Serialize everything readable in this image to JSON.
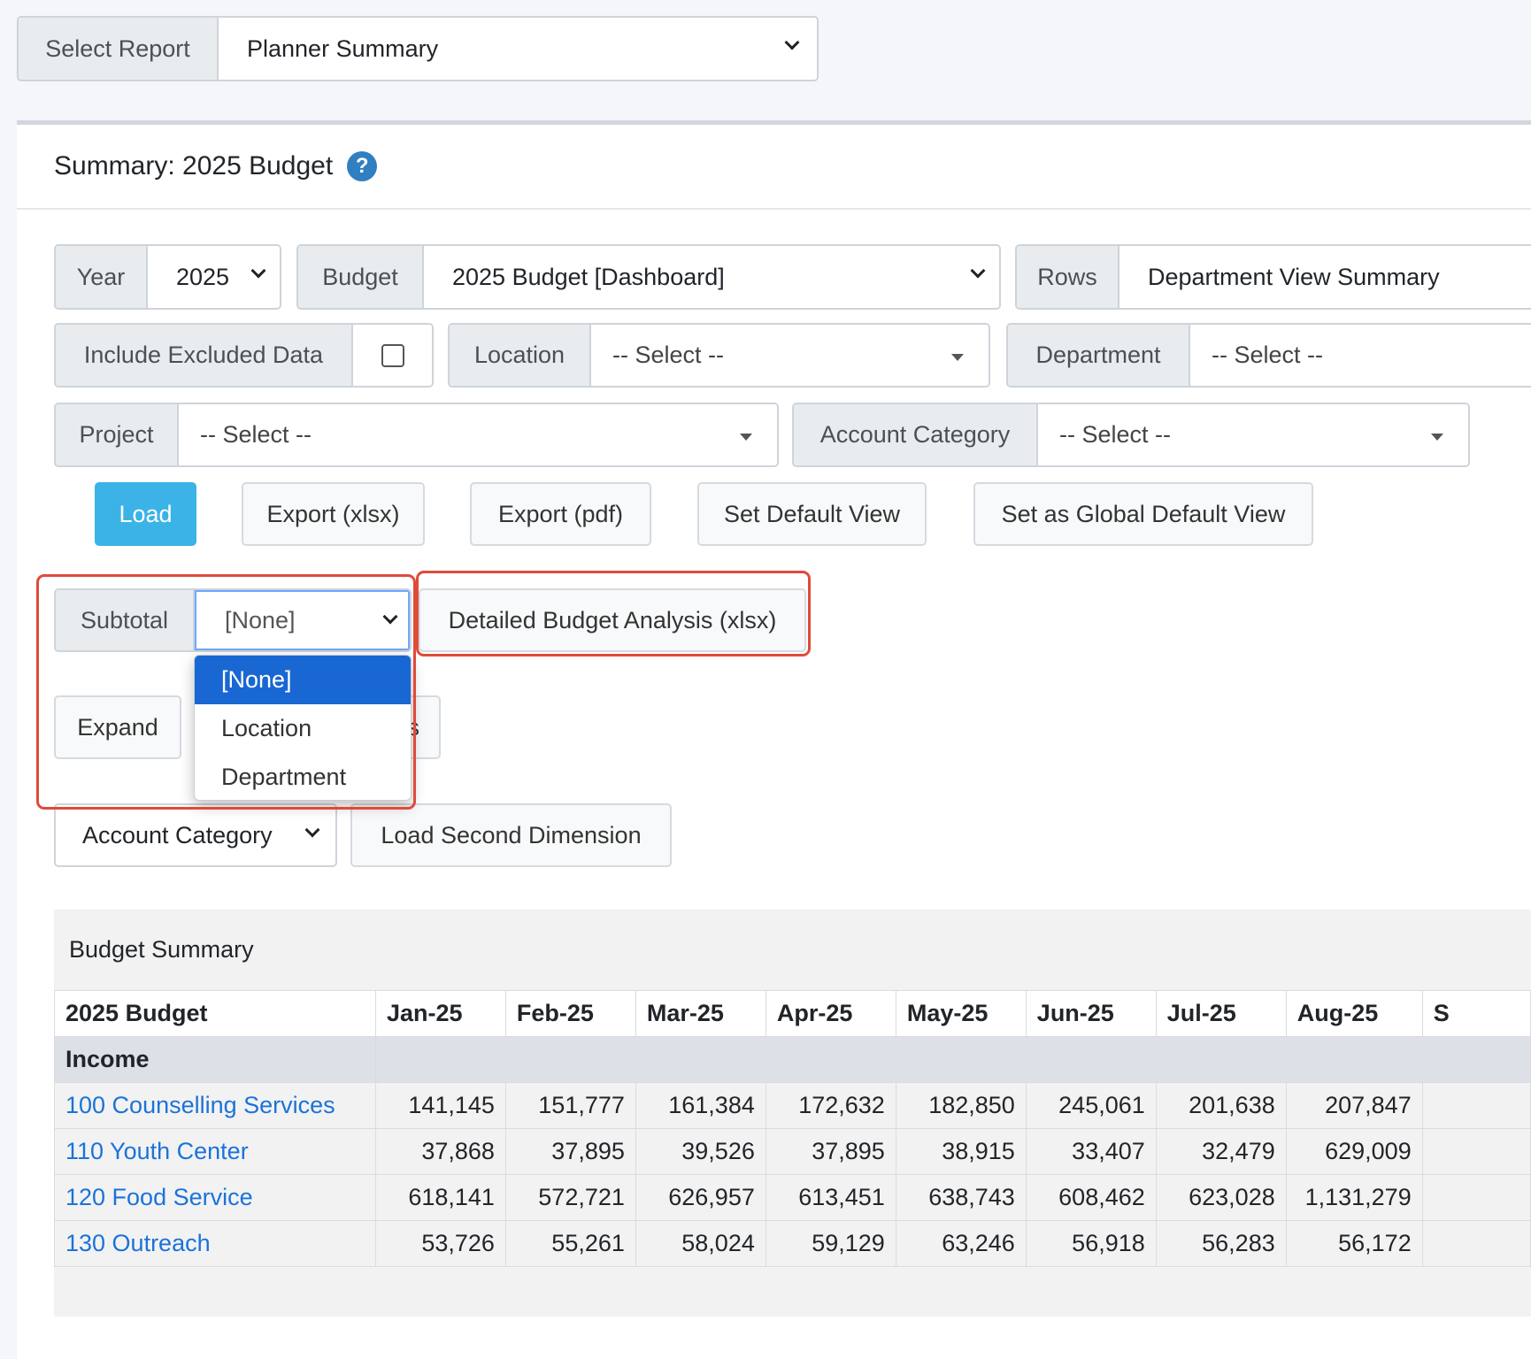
{
  "report_select": {
    "label": "Select Report",
    "value": "Planner Summary"
  },
  "panel": {
    "title": "Summary: 2025 Budget",
    "help_icon": "help-circle-icon"
  },
  "filters": {
    "year_label": "Year",
    "year_value": "2025",
    "budget_label": "Budget",
    "budget_value": "2025 Budget [Dashboard]",
    "rows_label": "Rows",
    "rows_value": "Department View Summary",
    "include_excluded_label": "Include Excluded Data",
    "include_excluded_checked": false,
    "location_label": "Location",
    "location_value": "-- Select --",
    "department_label": "Department",
    "department_value": "-- Select --",
    "project_label": "Project",
    "project_value": "-- Select --",
    "account_category_label": "Account Category",
    "account_category_value": "-- Select --"
  },
  "actions": {
    "load": "Load",
    "export_xlsx": "Export (xlsx)",
    "export_pdf": "Export (pdf)",
    "set_default": "Set Default View",
    "set_global_default": "Set as Global Default View"
  },
  "subtotal": {
    "label": "Subtotal",
    "value": "[None]",
    "options": [
      "[None]",
      "Location",
      "Department"
    ],
    "selected_index": 0
  },
  "detailed_analysis_button": "Detailed Budget Analysis (xlsx)",
  "expand_button": "Expand",
  "collapse_button_partial": "s",
  "second_dimension": {
    "select_value": "Account Category",
    "load_button": "Load Second Dimension"
  },
  "accent_colors": {
    "primary_button": "#3bb3e6",
    "link": "#1a73d9",
    "highlight": "#e04a3a",
    "selected_option": "#1967d2"
  },
  "table": {
    "section_title": "Budget Summary",
    "headers": [
      "2025 Budget",
      "Jan-25",
      "Feb-25",
      "Mar-25",
      "Apr-25",
      "May-25",
      "Jun-25",
      "Jul-25",
      "Aug-25",
      "S"
    ],
    "group": "Income",
    "rows": [
      {
        "name": "100 Counselling Services",
        "values": [
          "141,145",
          "151,777",
          "161,384",
          "172,632",
          "182,850",
          "245,061",
          "201,638",
          "207,847"
        ]
      },
      {
        "name": "110 Youth Center",
        "values": [
          "37,868",
          "37,895",
          "39,526",
          "37,895",
          "38,915",
          "33,407",
          "32,479",
          "629,009"
        ]
      },
      {
        "name": "120 Food Service",
        "values": [
          "618,141",
          "572,721",
          "626,957",
          "613,451",
          "638,743",
          "608,462",
          "623,028",
          "1,131,279"
        ]
      },
      {
        "name": "130 Outreach",
        "values": [
          "53,726",
          "55,261",
          "58,024",
          "59,129",
          "63,246",
          "56,918",
          "56,283",
          "56,172"
        ]
      }
    ]
  }
}
